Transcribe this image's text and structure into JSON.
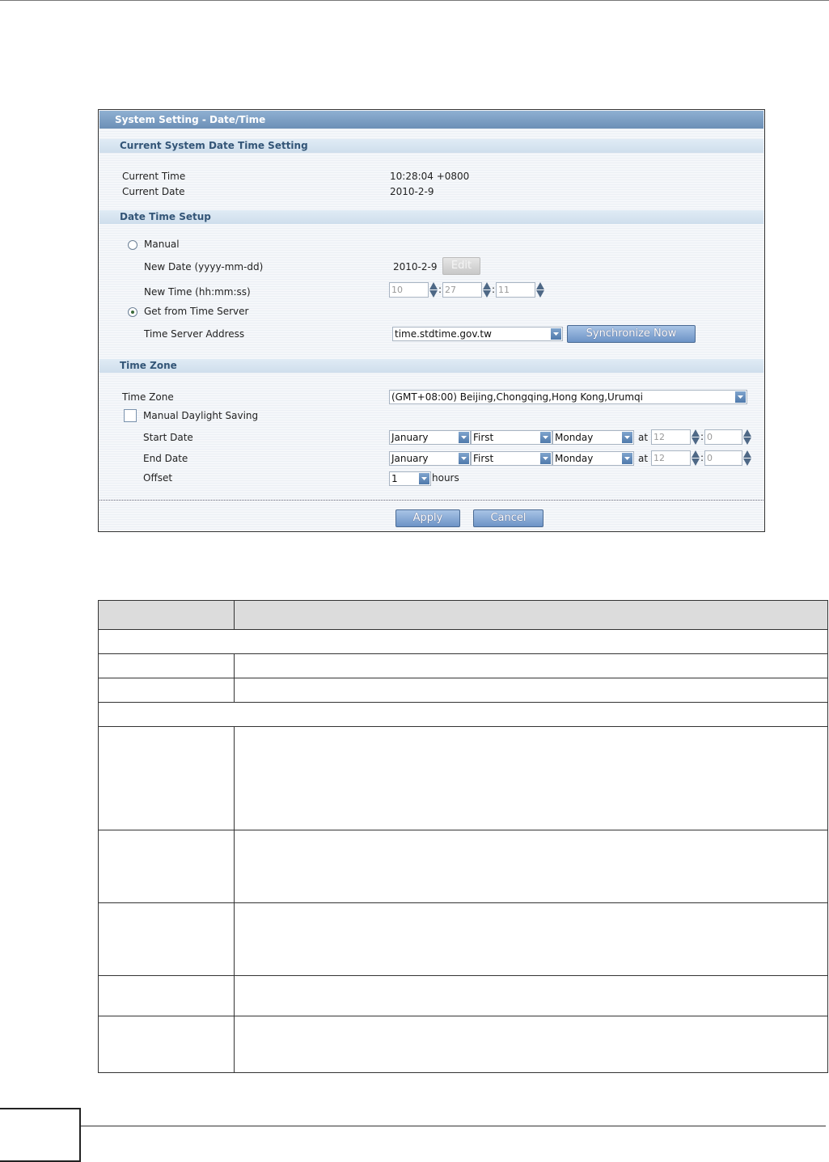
{
  "panel": {
    "title": "System Setting - Date/Time",
    "section_current": "Current System Date Time Setting",
    "current_time_label": "Current Time",
    "current_time_value": "10:28:04 +0800",
    "current_date_label": "Current Date",
    "current_date_value": "2010-2-9",
    "section_setup": "Date Time Setup",
    "manual_label": "Manual",
    "manual_selected": false,
    "new_date_label": "New Date (yyyy-mm-dd)",
    "new_date_value": "2010-2-9",
    "edit_label": "Edit",
    "new_time_label": "New Time (hh:mm:ss)",
    "hour": "10",
    "minute": "27",
    "second": "11",
    "colon": ":",
    "get_server_label": "Get from Time Server",
    "get_server_selected": true,
    "server_addr_label": "Time Server Address",
    "server_addr_value": "time.stdtime.gov.tw",
    "sync_label": "Synchronize Now",
    "section_tz": "Time Zone",
    "tz_label": "Time Zone",
    "tz_value": "(GMT+08:00) Beijing,Chongqing,Hong Kong,Urumqi",
    "dst_label": "Manual Daylight Saving",
    "dst_checked": false,
    "start_label": "Start Date",
    "end_label": "End Date",
    "month": "January",
    "week": "First",
    "day": "Monday",
    "at": "at",
    "at_hour": "12",
    "at_min": "0",
    "offset_label": "Offset",
    "offset_value": "1",
    "hours_label": "hours",
    "apply_label": "Apply",
    "cancel_label": "Cancel"
  },
  "icons": {
    "radio": "radio-icon",
    "checkbox": "checkbox-icon",
    "spinner": "spinner-icon",
    "dropdown": "chevron-down-icon"
  },
  "colors": {
    "title_bar": "#6c8fb6",
    "section_header": "#cfdeec",
    "button": "#6c93c6",
    "table_header": "#dcdcdc"
  }
}
